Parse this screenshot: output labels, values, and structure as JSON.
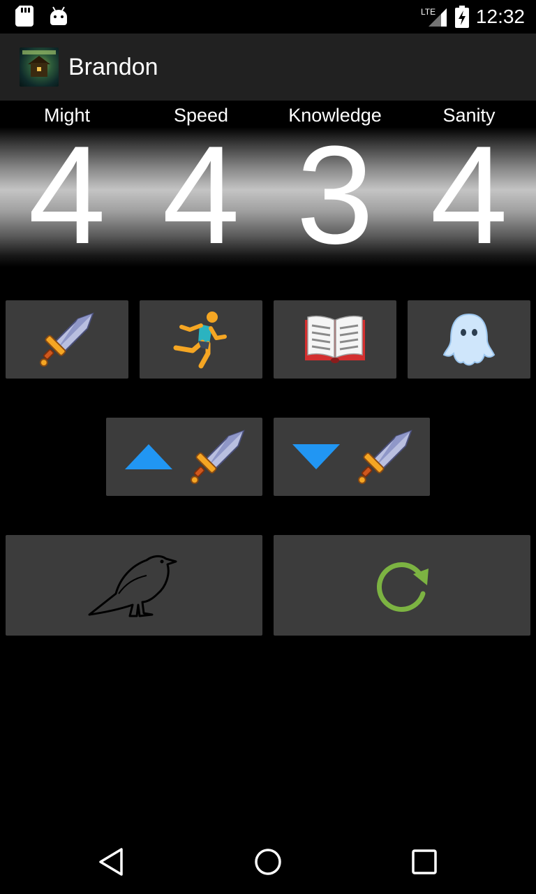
{
  "status_bar": {
    "network": "LTE",
    "time": "12:32"
  },
  "app": {
    "title": "Brandon"
  },
  "stats": [
    {
      "label": "Might",
      "value": "4"
    },
    {
      "label": "Speed",
      "value": "4"
    },
    {
      "label": "Knowledge",
      "value": "3"
    },
    {
      "label": "Sanity",
      "value": "4"
    }
  ],
  "trait_buttons": [
    {
      "icon": "sword-icon"
    },
    {
      "icon": "runner-icon"
    },
    {
      "icon": "book-icon"
    },
    {
      "icon": "ghost-icon"
    }
  ],
  "adjust_buttons": [
    {
      "icon": "triangle-up-icon",
      "target": "sword-icon"
    },
    {
      "icon": "triangle-down-icon",
      "target": "sword-icon"
    }
  ],
  "action_buttons": [
    {
      "icon": "raven-icon"
    },
    {
      "icon": "refresh-icon"
    }
  ],
  "colors": {
    "accent_blue": "#2196F3",
    "refresh_green": "#7CB342",
    "button_bg": "#3c3c3c",
    "action_bar": "#212121"
  }
}
